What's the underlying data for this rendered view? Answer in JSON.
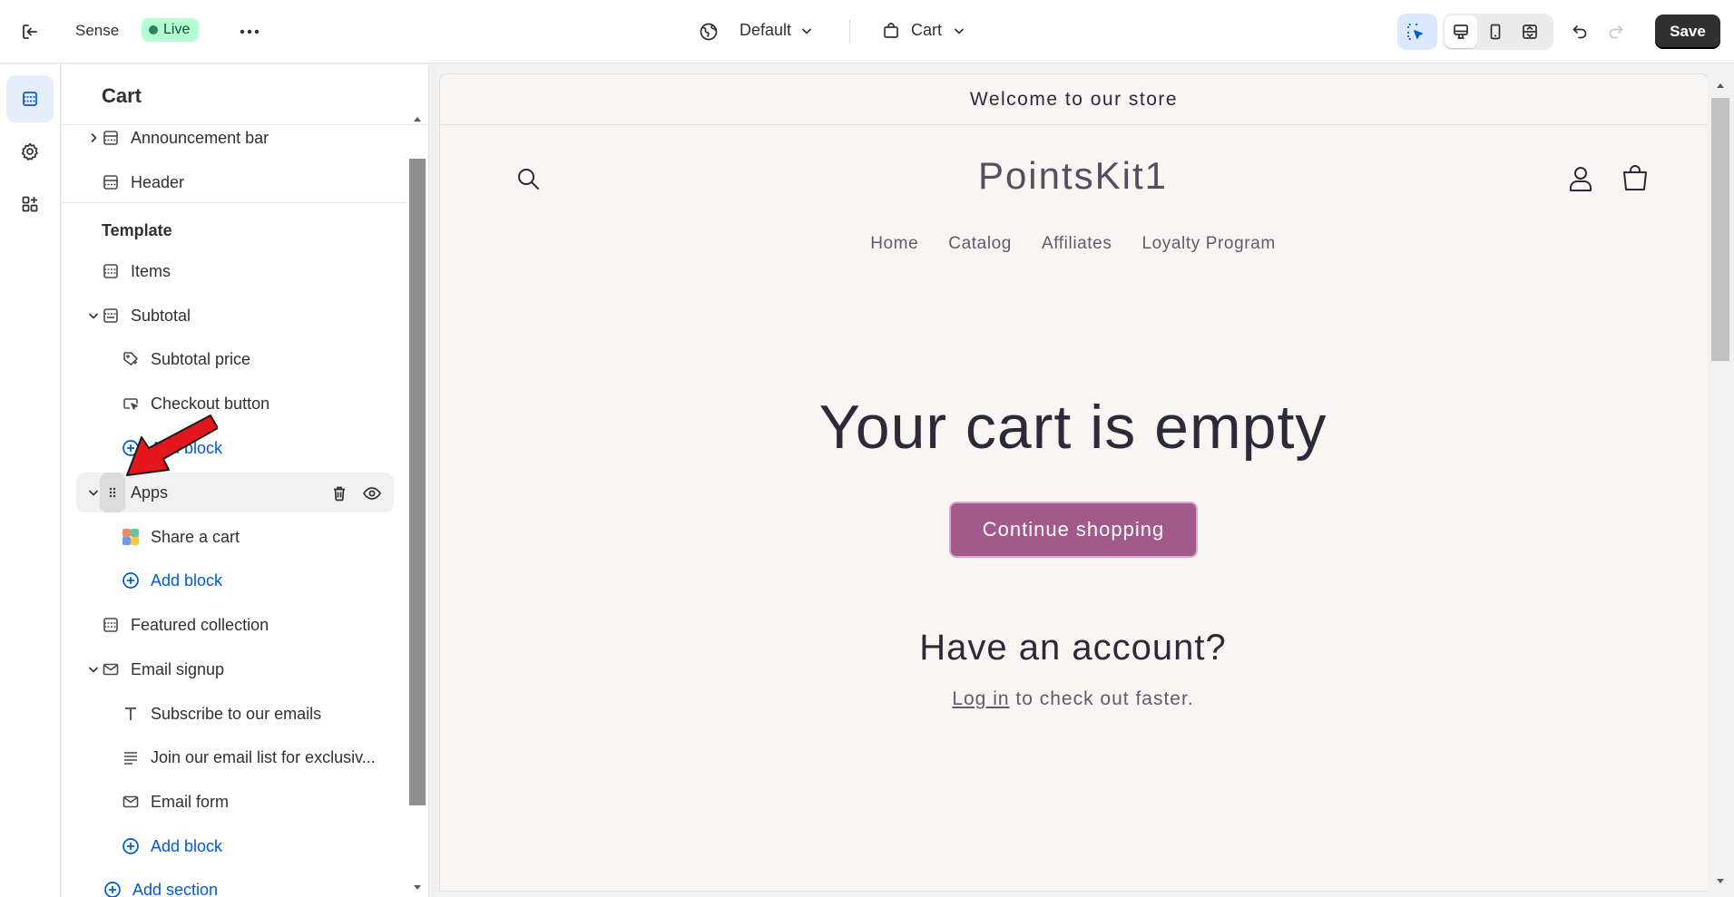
{
  "topbar": {
    "theme_name": "Sense",
    "live_badge": "Live",
    "template_selector": "Default",
    "page_selector": "Cart",
    "save_label": "Save"
  },
  "sidebar": {
    "title": "Cart",
    "header_sections": [
      {
        "label": "Announcement bar",
        "icon": "section-icon",
        "collapsed": true
      },
      {
        "label": "Header",
        "icon": "section-icon"
      }
    ],
    "template_group_label": "Template",
    "items_label": "Items",
    "subtotal": {
      "label": "Subtotal",
      "blocks": [
        "Subtotal price",
        "Checkout button"
      ],
      "add_block": "Add block"
    },
    "apps": {
      "label": "Apps",
      "blocks": [
        "Share a cart"
      ],
      "add_block": "Add block"
    },
    "featured_collection_label": "Featured collection",
    "email_signup": {
      "label": "Email signup",
      "blocks": [
        "Subscribe to our emails",
        "Join our email list for exclusiv...",
        "Email form"
      ],
      "add_block": "Add block"
    },
    "add_section_label": "Add section"
  },
  "preview": {
    "announcement": "Welcome to our store",
    "store_name": "PointsKit1",
    "nav": [
      "Home",
      "Catalog",
      "Affiliates",
      "Loyalty Program"
    ],
    "empty_title": "Your cart is empty",
    "continue_button": "Continue shopping",
    "account_title": "Have an account?",
    "login_link": "Log in",
    "login_suffix": " to check out faster."
  },
  "colors": {
    "accent_blue": "#005bd3",
    "live_badge_bg": "#b4fed2",
    "save_button_bg": "#303030",
    "preview_bg": "#f8f5f2",
    "continue_button_bg": "#a15a8b",
    "annotation_arrow": "#e3161b"
  }
}
